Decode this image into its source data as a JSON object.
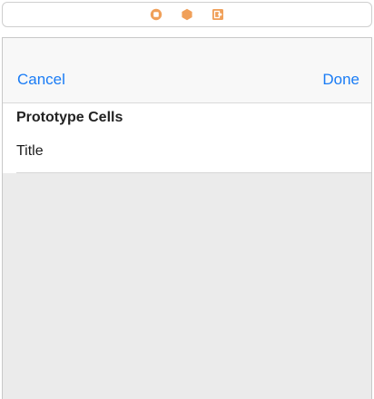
{
  "scene_dock": {
    "icons": [
      {
        "name": "view-controller-icon",
        "color": "#f0a05a"
      },
      {
        "name": "first-responder-icon",
        "color": "#f0a05a"
      },
      {
        "name": "exit-icon",
        "color": "#f0a05a"
      }
    ]
  },
  "nav_bar": {
    "cancel_label": "Cancel",
    "done_label": "Done",
    "accent_color": "#1a7cf5"
  },
  "table": {
    "section_header": "Prototype Cells",
    "cells": [
      {
        "title": "Title"
      }
    ]
  },
  "colors": {
    "background_empty": "#ebebeb",
    "nav_background": "#f8f8f8"
  }
}
